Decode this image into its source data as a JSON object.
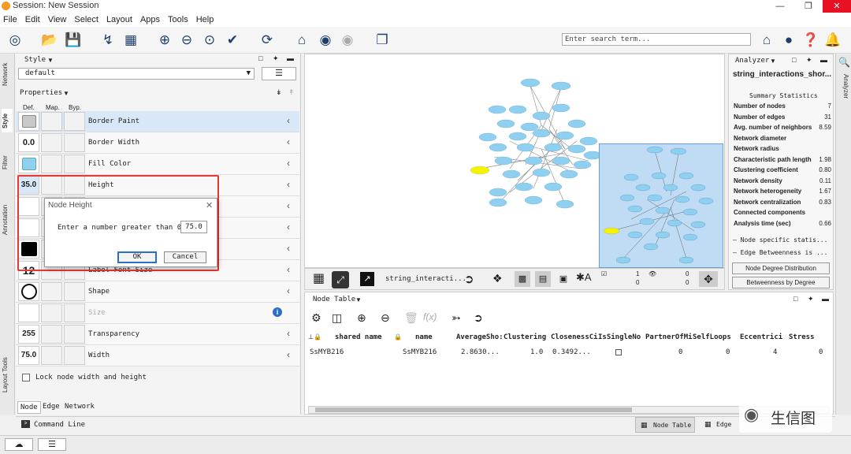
{
  "window": {
    "title": "Session: New Session"
  },
  "menu": [
    "File",
    "Edit",
    "View",
    "Select",
    "Layout",
    "Apps",
    "Tools",
    "Help"
  ],
  "search": {
    "placeholder": "Enter search term..."
  },
  "left_tabs": [
    "Network",
    "Style",
    "Filter",
    "Annotation",
    "Layout Tools"
  ],
  "style_panel": {
    "title": "Style",
    "style_name": "default",
    "properties_label": "Properties",
    "col_def": "Def.",
    "col_map": "Map.",
    "col_byp": "Byp.",
    "rows": [
      {
        "label": "Border Paint",
        "value": ""
      },
      {
        "label": "Border Width",
        "value": "0.0"
      },
      {
        "label": "Fill Color",
        "value": ""
      },
      {
        "label": "Height",
        "value": "35.0"
      },
      {
        "label": "Label Font Size",
        "value": "12"
      },
      {
        "label": "Shape",
        "value": ""
      },
      {
        "label": "Size",
        "value": ""
      },
      {
        "label": "Transparency",
        "value": "255"
      },
      {
        "label": "Width",
        "value": "75.0"
      }
    ],
    "lock_label": "Lock node width and height",
    "bottom_tabs": [
      "Node",
      "Edge",
      "Network"
    ]
  },
  "dialog": {
    "title": "Node Height",
    "prompt": "Enter a number greater than 0.0:",
    "value": "75.0",
    "ok": "OK",
    "cancel": "Cancel"
  },
  "network_toolbar": {
    "network_name": "string_interacti...",
    "count1": "1",
    "count2": "0",
    "count3": "0",
    "count4": "0"
  },
  "node_table": {
    "title": "Node Table",
    "columns": [
      "shared name",
      "name",
      "AverageSho:",
      "Clustering",
      "ClosenessCi",
      "IsSingleNo",
      "PartnerOfMi",
      "SelfLoops",
      "Eccentrici",
      "Stress"
    ],
    "row": [
      "SsMYB216",
      "SsMYB216",
      "2.8630...",
      "1.0",
      "0.3492...",
      "",
      "0",
      "0",
      "4",
      "0"
    ]
  },
  "analyzer": {
    "title": "Analyzer",
    "network": "string_interactions_shor...",
    "summary_title": "Summary Statistics",
    "stats": [
      {
        "k": "Number of nodes",
        "v": "7"
      },
      {
        "k": "Number of edges",
        "v": "31"
      },
      {
        "k": "Avg. number of neighbors",
        "v": "8.59"
      },
      {
        "k": "Network diameter",
        "v": ""
      },
      {
        "k": "Network radius",
        "v": ""
      },
      {
        "k": "Characteristic path length",
        "v": "1.98"
      },
      {
        "k": "Clustering coefficient",
        "v": "0.80"
      },
      {
        "k": "Network density",
        "v": "0.11"
      },
      {
        "k": "Network heterogeneity",
        "v": "1.67"
      },
      {
        "k": "Network centralization",
        "v": "0.83"
      },
      {
        "k": "Connected components",
        "v": ""
      },
      {
        "k": "Analysis time (sec)",
        "v": "0.66"
      }
    ],
    "node_stats": "– Node specific statis...",
    "edge_betweenness": "– Edge Betweenness is ...",
    "btn_degree": "Node Degree Distribution",
    "btn_betweenness": "Betweenness by Degree"
  },
  "right_tab": "Analyzer",
  "bottom": {
    "command_line": "Command Line",
    "tab_node_table": "Node Table",
    "tab_edge": "Edge",
    "watermark": "生信图"
  },
  "colors": {
    "node_fill": "#8fd0f0",
    "selected_node": "#f4f400",
    "accent": "#e53935"
  }
}
